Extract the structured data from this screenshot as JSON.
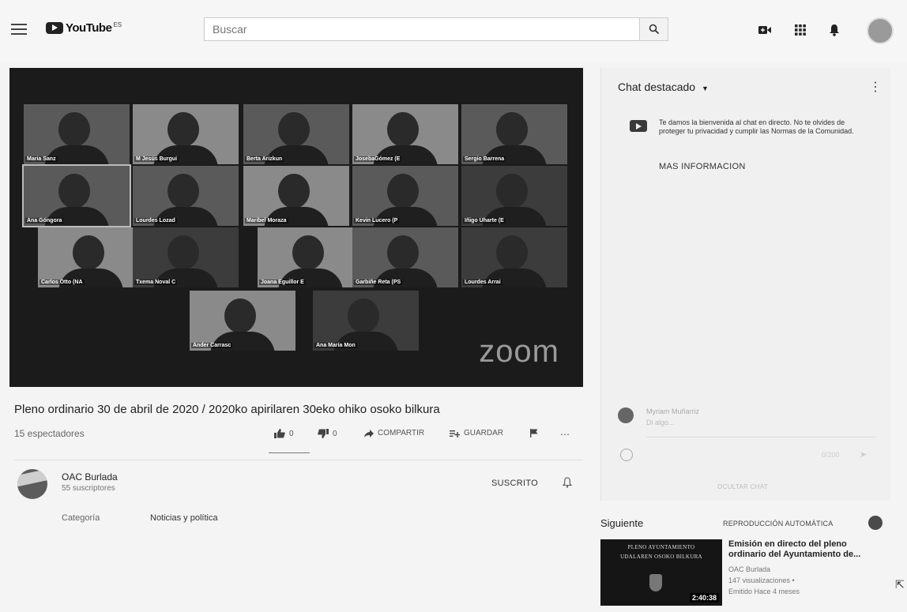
{
  "topbar": {
    "logo_text": "YouTube",
    "logo_sup": "ES",
    "search_placeholder": "Buscar"
  },
  "video": {
    "watermark": "zoom",
    "participants": [
      "Maria Sanz",
      "M Jesús Burgui",
      "Berta Arizkun",
      "JosebaGómez (E",
      "Sergio Barrena",
      "Ana Góngora",
      "Lourdes Lozad",
      "Maribel Moraza",
      "Kevin Lucero (P",
      "Iñigo Uharte (E",
      "Carlos Otto (NA",
      "Txema Noval C",
      "Joana Eguillor E",
      "Garbiñe Reta (PS",
      "Lourdes Arrai",
      "Ander Carrasc",
      "Ana María Mon"
    ]
  },
  "title": "Pleno ordinario 30 de abril de 2020 / 2020ko apirilaren 30eko ohiko osoko bilkura",
  "viewers": "15 espectadores",
  "actions": {
    "likes": "0",
    "dislikes": "0",
    "share": "COMPARTIR",
    "save": "GUARDAR"
  },
  "channel": {
    "name": "OAC Burlada",
    "subscribers": "55 suscriptores",
    "subscribed": "SUSCRITO",
    "category_label": "Categoría",
    "category_value": "Noticias y política"
  },
  "chat": {
    "header": "Chat destacado",
    "welcome": "Te damos la bienvenida al chat en directo. No te olvides de proteger tu privacidad y cumplir las Normas de la Comunidad.",
    "more_info": "MAS INFORMACION",
    "user_name": "Myriam Muñarriz",
    "say_placeholder": "Di algo...",
    "char_count": "0/200",
    "hide": "OCULTAR CHAT"
  },
  "next": {
    "label": "Siguiente",
    "autoplay": "REPRODUCCIÓN AUTOMÁTICA",
    "thumb_line1": "PLENO AYUNTAMIENTO",
    "thumb_line2": "UDALAREN OSOKO BILKURA",
    "duration": "2:40:38",
    "title": "Emisión en directo del pleno ordinario del Ayuntamiento de...",
    "channel": "OAC Burlada",
    "views": "147 visualizaciones •",
    "time": "Emitido Hace 4 meses"
  }
}
